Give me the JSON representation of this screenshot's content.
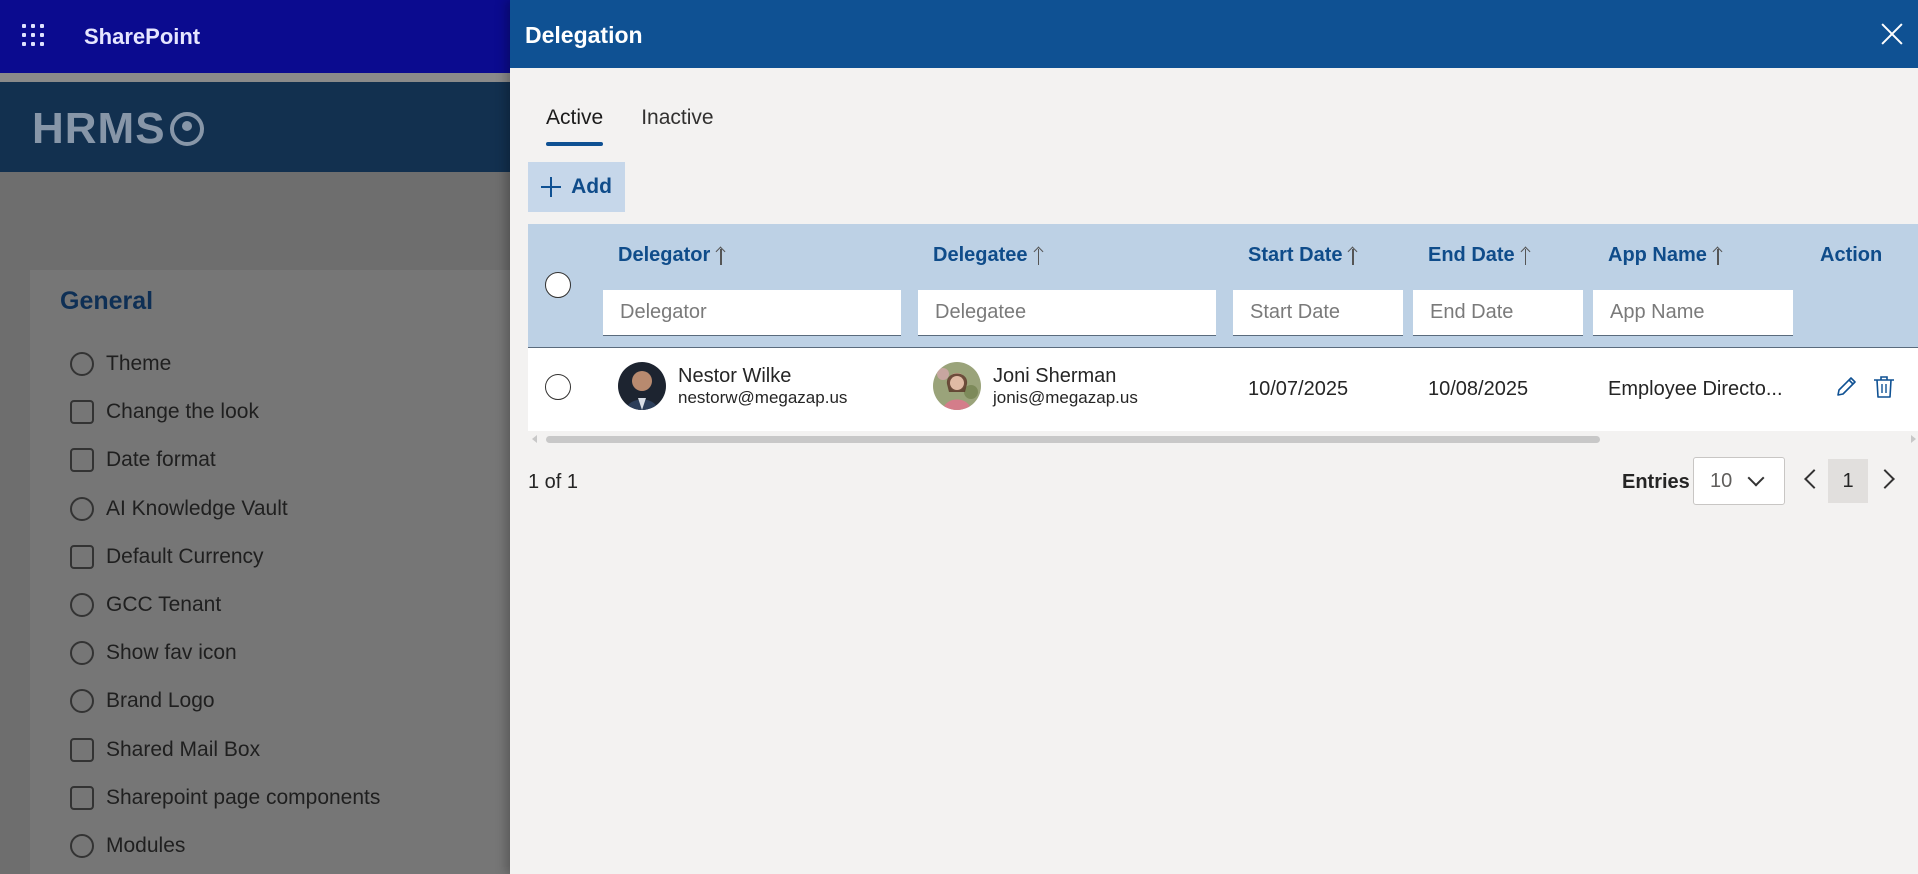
{
  "suite": {
    "title": "SharePoint"
  },
  "site": {
    "logo_text": "HRMS"
  },
  "settings": {
    "heading": "General",
    "items": [
      {
        "label": "Theme",
        "icon": "palette-icon"
      },
      {
        "label": "Change the look",
        "icon": "change-look-icon"
      },
      {
        "label": "Date format",
        "icon": "calendar-icon"
      },
      {
        "label": "AI Knowledge Vault",
        "icon": "people-view-icon"
      },
      {
        "label": "Default Currency",
        "icon": "currency-icon"
      },
      {
        "label": "GCC Tenant",
        "icon": "org-chart-icon"
      },
      {
        "label": "Show fav icon",
        "icon": "sharepoint-icon"
      },
      {
        "label": "Brand Logo",
        "icon": "badge-icon"
      },
      {
        "label": "Shared Mail Box",
        "icon": "mail-settings-icon"
      },
      {
        "label": "Sharepoint page components",
        "icon": "page-icon"
      },
      {
        "label": "Modules",
        "icon": "hidden-icon"
      }
    ]
  },
  "panel": {
    "title": "Delegation",
    "tabs": [
      {
        "label": "Active"
      },
      {
        "label": "Inactive"
      }
    ],
    "add_label": "Add",
    "columns": {
      "delegator": "Delegator",
      "delegatee": "Delegatee",
      "start_date": "Start Date",
      "end_date": "End Date",
      "app_name": "App Name",
      "action": "Action"
    },
    "filters": {
      "delegator": "Delegator",
      "delegatee": "Delegatee",
      "start_date": "Start Date",
      "end_date": "End Date",
      "app_name": "App Name"
    },
    "rows": [
      {
        "delegator_name": "Nestor Wilke",
        "delegator_email": "nestorw@megazap.us",
        "delegatee_name": "Joni Sherman",
        "delegatee_email": "jonis@megazap.us",
        "start_date": "10/07/2025",
        "end_date": "10/08/2025",
        "app_name": "Employee Directo..."
      }
    ],
    "pager": {
      "info": "1 of 1",
      "entries_label": "Entries",
      "entries_value": "10",
      "current_page": "1"
    }
  },
  "colors": {
    "panel_header": "#0f5193",
    "suite_bar": "#0b0b8f",
    "grid_header": "#bdd1e5",
    "accent_text": "#0f4c8a"
  }
}
